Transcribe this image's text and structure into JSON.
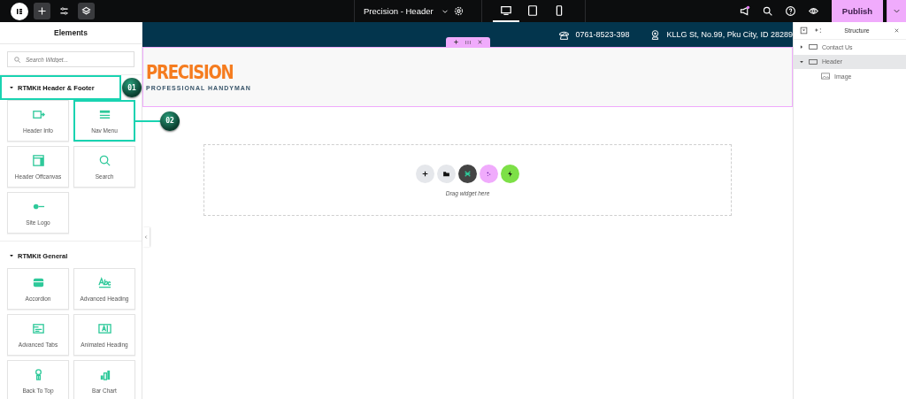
{
  "topbar": {
    "tools": [
      {
        "kind": "add",
        "selected": true
      },
      {
        "kind": "settings",
        "selected": false
      },
      {
        "kind": "layers",
        "selected": true
      }
    ],
    "document_title": "Precision - Header",
    "devices": [
      {
        "kind": "desktop",
        "selected": true
      },
      {
        "kind": "tablet",
        "selected": false
      },
      {
        "kind": "mobile",
        "selected": false
      }
    ],
    "publish": "Publish"
  },
  "panel": {
    "title": "Elements",
    "search": {
      "placeholder": "Search Widget..."
    },
    "sections": [
      {
        "title": "RTMKit Header & Footer",
        "highlighted": true,
        "callout": "01",
        "widgets": [
          {
            "label": "Header Info",
            "highlighted": false
          },
          {
            "label": "Nav Menu",
            "highlighted": true,
            "callout": "02"
          },
          {
            "label": "Header Offcanvas",
            "highlighted": false
          },
          {
            "label": "Search",
            "highlighted": false
          },
          {
            "label": "Site Logo",
            "highlighted": false
          }
        ]
      },
      {
        "title": "RTMKit General",
        "highlighted": false,
        "widgets": [
          {
            "label": "Accordion",
            "highlighted": false
          },
          {
            "label": "Advanced Heading",
            "highlighted": false
          },
          {
            "label": "Advanced Tabs",
            "highlighted": false
          },
          {
            "label": "Animated Heading",
            "highlighted": false
          },
          {
            "label": "Back To Top",
            "highlighted": false
          },
          {
            "label": "Bar Chart",
            "highlighted": false
          }
        ]
      }
    ]
  },
  "canvas": {
    "topbar": {
      "phone": "0761-8523-398",
      "address": "KLLG St, No.99, Pku City, ID 28289"
    },
    "logo": {
      "title": "PRECISION",
      "tagline": "PROFESSIONAL HANDYMAN"
    },
    "drop_zone": {
      "buttons": [
        {
          "kind": "add"
        },
        {
          "kind": "template"
        },
        {
          "kind": "kit"
        },
        {
          "kind": "ai"
        },
        {
          "kind": "quick"
        }
      ],
      "hint": "Drag widget here"
    }
  },
  "structure": {
    "title": "Structure",
    "items": [
      {
        "label": "Contact Us",
        "kind": "container",
        "expanded": false,
        "selected": false
      },
      {
        "label": "Header",
        "kind": "container",
        "expanded": true,
        "selected": true,
        "children": [
          {
            "label": "Image",
            "kind": "image",
            "selected": false
          }
        ]
      }
    ]
  }
}
